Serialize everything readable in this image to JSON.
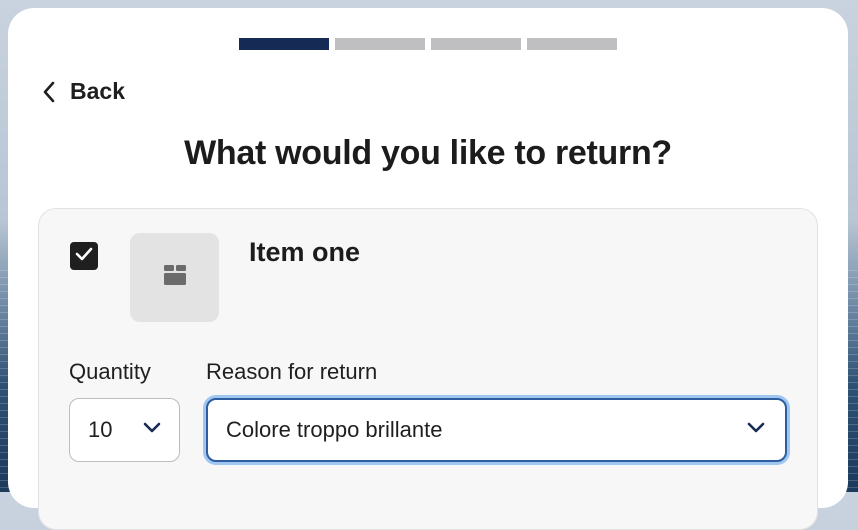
{
  "progress": {
    "total_steps": 4,
    "current_step": 1
  },
  "nav": {
    "back_label": "Back"
  },
  "page": {
    "title": "What would you like to return?"
  },
  "item": {
    "name": "Item one",
    "selected": true,
    "thumbnail_icon": "box-icon"
  },
  "quantity": {
    "label": "Quantity",
    "value": "10"
  },
  "reason": {
    "label": "Reason for return",
    "value": "Colore troppo brillante"
  },
  "colors": {
    "accent": "#152a55",
    "focus_ring": "#9fc7f2"
  }
}
